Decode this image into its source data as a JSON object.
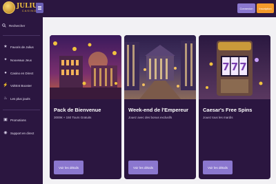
{
  "header": {
    "logo_name": "JULIUS",
    "logo_sub": "CASINO",
    "connect_label": "Connexion",
    "register_label": "Inscription"
  },
  "sidebar": {
    "search_label": "Rechercher",
    "items": [
      {
        "label": "Favoris de Julius",
        "icon": "star-icon"
      },
      {
        "label": "Nouveaux Jeux",
        "icon": "new-icon"
      },
      {
        "label": "Casino en Direct",
        "icon": "live-icon"
      },
      {
        "label": "VoltEnt Booster",
        "icon": "bolt-icon"
      },
      {
        "label": "Les plus joués",
        "icon": "fire-icon"
      },
      {
        "label": "Promotions",
        "icon": "gift-icon"
      },
      {
        "label": "Support en direct",
        "icon": "chat-icon"
      }
    ]
  },
  "cards": [
    {
      "title": "Pack de Bienvenue",
      "description": "3000€ + 150 Tours Gratuits",
      "button": "Voir les détails"
    },
    {
      "title": "Week-end de l'Empereur",
      "description": "Jouez avec des bonus exclusifs",
      "button": "Voir les détails"
    },
    {
      "title": "Caesar's Free Spins",
      "description": "Jouez tous les mardis",
      "button": "Voir les détails"
    }
  ],
  "colors": {
    "sidebar_bg": "#2b1640",
    "accent_purple": "#8b77cf",
    "accent_orange": "#f39a2b",
    "gold": "#f1c23f"
  }
}
